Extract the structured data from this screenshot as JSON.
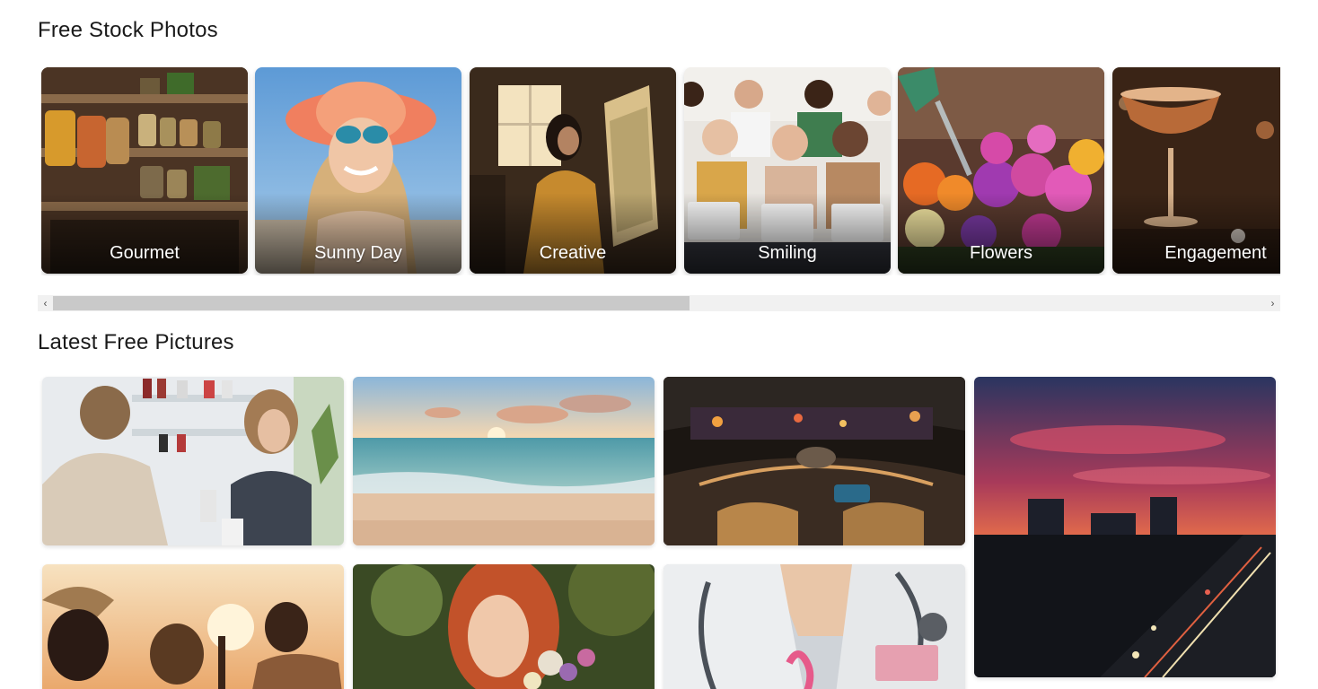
{
  "sections": {
    "stock_title": "Free Stock Photos",
    "latest_title": "Latest Free Pictures"
  },
  "categories": [
    {
      "label": "Gourmet"
    },
    {
      "label": "Sunny Day"
    },
    {
      "label": "Creative"
    },
    {
      "label": "Smiling"
    },
    {
      "label": "Flowers"
    },
    {
      "label": "Engagement"
    }
  ],
  "scrollbar": {
    "left_arrow": "‹",
    "right_arrow": "›",
    "position": 0.0
  },
  "photos": [
    {
      "subject": "pharmacy consultation"
    },
    {
      "subject": "beach sunset"
    },
    {
      "subject": "futuristic car interior"
    },
    {
      "subject": "city skyline at dusk"
    },
    {
      "subject": "friends at beach sunset"
    },
    {
      "subject": "red-haired woman with flowers"
    },
    {
      "subject": "doctor with pink ribbon"
    }
  ]
}
